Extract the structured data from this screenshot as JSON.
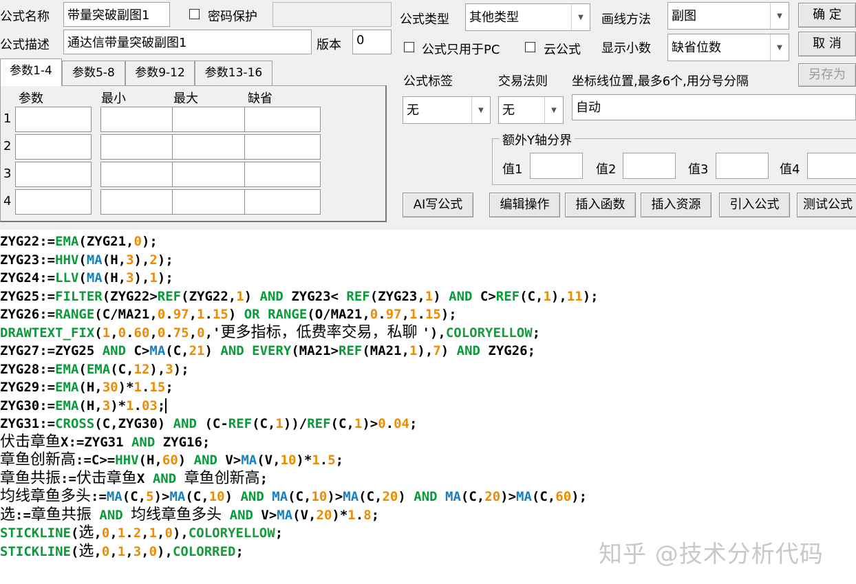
{
  "header": {
    "name_label": "公式名称",
    "name_value": "带量突破副图1",
    "password_label": "密码保护",
    "desc_label": "公式描述",
    "desc_value": "通达信带量突破副图1",
    "version_label": "版本",
    "version_value": "0",
    "type_label": "公式类型",
    "type_value": "其他类型",
    "draw_label": "画线方法",
    "draw_value": "副图",
    "pc_only_label": "公式只用于PC",
    "cloud_label": "云公式",
    "decimal_label": "显示小数",
    "decimal_value": "缺省位数",
    "tag_label": "公式标签",
    "tag_value": "无",
    "trade_label": "交易法则",
    "trade_value": "无",
    "axis_label": "坐标线位置,最多6个,用分号分隔",
    "axis_value": "自动",
    "extra_y_label": "额外Y轴分界",
    "y_labels": [
      "值1",
      "值2",
      "值3",
      "值4"
    ]
  },
  "buttons": {
    "ok": "确 定",
    "cancel": "取 消",
    "save_as": "另存为",
    "ai": "AI写公式",
    "edit": "编辑操作",
    "insert_func": "插入函数",
    "insert_res": "插入资源",
    "import": "引入公式",
    "test": "测试公式"
  },
  "params": {
    "tabs": [
      "参数1-4",
      "参数5-8",
      "参数9-12",
      "参数13-16"
    ],
    "columns": [
      "参数",
      "最小",
      "最大",
      "缺省"
    ],
    "rows": [
      "1",
      "2",
      "3",
      "4"
    ]
  },
  "code_lines": [
    [
      [
        "k",
        "ZYG22:="
      ],
      [
        "f",
        "EMA"
      ],
      [
        "k",
        "(ZYG21,"
      ],
      [
        "n",
        "0"
      ],
      [
        "k",
        ");"
      ]
    ],
    [
      [
        "k",
        "ZYG23:="
      ],
      [
        "f",
        "HHV"
      ],
      [
        "k",
        "("
      ],
      [
        "m",
        "MA"
      ],
      [
        "k",
        "(H,"
      ],
      [
        "n",
        "3"
      ],
      [
        "k",
        "),"
      ],
      [
        "n",
        "2"
      ],
      [
        "k",
        ");"
      ]
    ],
    [
      [
        "k",
        "ZYG24:="
      ],
      [
        "f",
        "LLV"
      ],
      [
        "k",
        "("
      ],
      [
        "m",
        "MA"
      ],
      [
        "k",
        "(H,"
      ],
      [
        "n",
        "3"
      ],
      [
        "k",
        "),"
      ],
      [
        "n",
        "1"
      ],
      [
        "k",
        ");"
      ]
    ],
    [
      [
        "k",
        "ZYG25:="
      ],
      [
        "f",
        "FILTER"
      ],
      [
        "k",
        "(ZYG22>"
      ],
      [
        "f",
        "REF"
      ],
      [
        "k",
        "(ZYG22,"
      ],
      [
        "n",
        "1"
      ],
      [
        "k",
        ") "
      ],
      [
        "f",
        "AND"
      ],
      [
        "k",
        " ZYG23< "
      ],
      [
        "f",
        "REF"
      ],
      [
        "k",
        "(ZYG23,"
      ],
      [
        "n",
        "1"
      ],
      [
        "k",
        ") "
      ],
      [
        "f",
        "AND"
      ],
      [
        "k",
        " C>"
      ],
      [
        "f",
        "REF"
      ],
      [
        "k",
        "(C,"
      ],
      [
        "n",
        "1"
      ],
      [
        "k",
        "),"
      ],
      [
        "n",
        "11"
      ],
      [
        "k",
        ");"
      ]
    ],
    [
      [
        "k",
        "ZYG26:="
      ],
      [
        "f",
        "RANGE"
      ],
      [
        "k",
        "(C/MA21,"
      ],
      [
        "n",
        "0"
      ],
      [
        "k",
        "."
      ],
      [
        "n",
        "97"
      ],
      [
        "k",
        ","
      ],
      [
        "n",
        "1"
      ],
      [
        "k",
        "."
      ],
      [
        "n",
        "15"
      ],
      [
        "k",
        ") "
      ],
      [
        "f",
        "OR"
      ],
      [
        "k",
        " "
      ],
      [
        "f",
        "RANGE"
      ],
      [
        "k",
        "(O/MA21,"
      ],
      [
        "n",
        "0"
      ],
      [
        "k",
        "."
      ],
      [
        "n",
        "97"
      ],
      [
        "k",
        ","
      ],
      [
        "n",
        "1"
      ],
      [
        "k",
        "."
      ],
      [
        "n",
        "15"
      ],
      [
        "k",
        ");"
      ]
    ],
    [
      [
        "f",
        "DRAWTEXT_FIX"
      ],
      [
        "k",
        "("
      ],
      [
        "n",
        "1"
      ],
      [
        "k",
        ","
      ],
      [
        "n",
        "0"
      ],
      [
        "k",
        "."
      ],
      [
        "n",
        "60"
      ],
      [
        "k",
        ","
      ],
      [
        "n",
        "0"
      ],
      [
        "k",
        "."
      ],
      [
        "n",
        "75"
      ],
      [
        "k",
        ","
      ],
      [
        "n",
        "0"
      ],
      [
        "k",
        ",'"
      ],
      [
        "c",
        "更多指标，低费率交易，私聊 "
      ],
      [
        "k",
        "'),"
      ],
      [
        "w",
        "COLORYELLOW"
      ],
      [
        "k",
        ";"
      ]
    ],
    [
      [
        "k",
        "ZYG27:=ZYG25 "
      ],
      [
        "f",
        "AND"
      ],
      [
        "k",
        " C>"
      ],
      [
        "m",
        "MA"
      ],
      [
        "k",
        "(C,"
      ],
      [
        "n",
        "21"
      ],
      [
        "k",
        ") "
      ],
      [
        "f",
        "AND"
      ],
      [
        "k",
        " "
      ],
      [
        "f",
        "EVERY"
      ],
      [
        "k",
        "(MA21>"
      ],
      [
        "f",
        "REF"
      ],
      [
        "k",
        "(MA21,"
      ],
      [
        "n",
        "1"
      ],
      [
        "k",
        "),"
      ],
      [
        "n",
        "7"
      ],
      [
        "k",
        ") "
      ],
      [
        "f",
        "AND"
      ],
      [
        "k",
        " ZYG26;"
      ]
    ],
    [
      [
        "k",
        "ZYG28:="
      ],
      [
        "f",
        "EMA"
      ],
      [
        "k",
        "("
      ],
      [
        "f",
        "EMA"
      ],
      [
        "k",
        "(C,"
      ],
      [
        "n",
        "12"
      ],
      [
        "k",
        "),"
      ],
      [
        "n",
        "3"
      ],
      [
        "k",
        ");"
      ]
    ],
    [
      [
        "k",
        "ZYG29:="
      ],
      [
        "f",
        "EMA"
      ],
      [
        "k",
        "(H,"
      ],
      [
        "n",
        "30"
      ],
      [
        "k",
        ")*"
      ],
      [
        "n",
        "1"
      ],
      [
        "k",
        "."
      ],
      [
        "n",
        "15"
      ],
      [
        "k",
        ";"
      ]
    ],
    [
      [
        "k",
        "ZYG30:="
      ],
      [
        "f",
        "EMA"
      ],
      [
        "k",
        "(H,"
      ],
      [
        "n",
        "3"
      ],
      [
        "k",
        ")*"
      ],
      [
        "n",
        "1"
      ],
      [
        "k",
        "."
      ],
      [
        "n",
        "03"
      ],
      [
        "k",
        ";"
      ],
      [
        "caret",
        ""
      ]
    ],
    [
      [
        "k",
        "ZYG31:="
      ],
      [
        "f",
        "CROSS"
      ],
      [
        "k",
        "(C,ZYG30) "
      ],
      [
        "f",
        "AND"
      ],
      [
        "k",
        " (C-"
      ],
      [
        "f",
        "REF"
      ],
      [
        "k",
        "(C,"
      ],
      [
        "n",
        "1"
      ],
      [
        "k",
        "))/"
      ],
      [
        "f",
        "REF"
      ],
      [
        "k",
        "(C,"
      ],
      [
        "n",
        "1"
      ],
      [
        "k",
        ")>"
      ],
      [
        "n",
        "0"
      ],
      [
        "k",
        "."
      ],
      [
        "n",
        "04"
      ],
      [
        "k",
        ";"
      ]
    ],
    [
      [
        "c",
        "伏击章鱼"
      ],
      [
        "k",
        "X:=ZYG31 "
      ],
      [
        "f",
        "AND"
      ],
      [
        "k",
        " ZYG16;"
      ]
    ],
    [
      [
        "c",
        "章鱼创新高"
      ],
      [
        "k",
        ":=C>="
      ],
      [
        "f",
        "HHV"
      ],
      [
        "k",
        "(H,"
      ],
      [
        "n",
        "60"
      ],
      [
        "k",
        ") "
      ],
      [
        "f",
        "AND"
      ],
      [
        "k",
        " V>"
      ],
      [
        "m",
        "MA"
      ],
      [
        "k",
        "(V,"
      ],
      [
        "n",
        "10"
      ],
      [
        "k",
        ")*"
      ],
      [
        "n",
        "1"
      ],
      [
        "k",
        "."
      ],
      [
        "n",
        "5"
      ],
      [
        "k",
        ";"
      ]
    ],
    [
      [
        "c",
        "章鱼共振"
      ],
      [
        "k",
        ":="
      ],
      [
        "c",
        "伏击章鱼"
      ],
      [
        "k",
        "X "
      ],
      [
        "f",
        "AND"
      ],
      [
        "k",
        " "
      ],
      [
        "c",
        "章鱼创新高"
      ],
      [
        "k",
        ";"
      ]
    ],
    [
      [
        "c",
        "均线章鱼多头"
      ],
      [
        "k",
        ":="
      ],
      [
        "m",
        "MA"
      ],
      [
        "k",
        "(C,"
      ],
      [
        "n",
        "5"
      ],
      [
        "k",
        ")>"
      ],
      [
        "m",
        "MA"
      ],
      [
        "k",
        "(C,"
      ],
      [
        "n",
        "10"
      ],
      [
        "k",
        ") "
      ],
      [
        "f",
        "AND"
      ],
      [
        "k",
        " "
      ],
      [
        "m",
        "MA"
      ],
      [
        "k",
        "(C,"
      ],
      [
        "n",
        "10"
      ],
      [
        "k",
        ")>"
      ],
      [
        "m",
        "MA"
      ],
      [
        "k",
        "(C,"
      ],
      [
        "n",
        "20"
      ],
      [
        "k",
        ") "
      ],
      [
        "f",
        "AND"
      ],
      [
        "k",
        " "
      ],
      [
        "m",
        "MA"
      ],
      [
        "k",
        "(C,"
      ],
      [
        "n",
        "20"
      ],
      [
        "k",
        ")>"
      ],
      [
        "m",
        "MA"
      ],
      [
        "k",
        "(C,"
      ],
      [
        "n",
        "60"
      ],
      [
        "k",
        ");"
      ]
    ],
    [
      [
        "c",
        "选"
      ],
      [
        "k",
        ":="
      ],
      [
        "c",
        "章鱼共振"
      ],
      [
        "k",
        " "
      ],
      [
        "f",
        "AND"
      ],
      [
        "k",
        " "
      ],
      [
        "c",
        "均线章鱼多头"
      ],
      [
        "k",
        " "
      ],
      [
        "f",
        "AND"
      ],
      [
        "k",
        " V>"
      ],
      [
        "m",
        "MA"
      ],
      [
        "k",
        "(V,"
      ],
      [
        "n",
        "20"
      ],
      [
        "k",
        ")*"
      ],
      [
        "n",
        "1"
      ],
      [
        "k",
        "."
      ],
      [
        "n",
        "8"
      ],
      [
        "k",
        ";"
      ]
    ],
    [
      [
        "f",
        "STICKLINE"
      ],
      [
        "k",
        "("
      ],
      [
        "c",
        "选"
      ],
      [
        "k",
        ","
      ],
      [
        "n",
        "0"
      ],
      [
        "k",
        ","
      ],
      [
        "n",
        "1"
      ],
      [
        "k",
        "."
      ],
      [
        "n",
        "2"
      ],
      [
        "k",
        ","
      ],
      [
        "n",
        "1"
      ],
      [
        "k",
        ","
      ],
      [
        "n",
        "0"
      ],
      [
        "k",
        "),"
      ],
      [
        "w",
        "COLORYELLOW"
      ],
      [
        "k",
        ";"
      ]
    ],
    [
      [
        "f",
        "STICKLINE"
      ],
      [
        "k",
        "("
      ],
      [
        "c",
        "选"
      ],
      [
        "k",
        ","
      ],
      [
        "n",
        "0"
      ],
      [
        "k",
        ","
      ],
      [
        "n",
        "1"
      ],
      [
        "k",
        ","
      ],
      [
        "n",
        "3"
      ],
      [
        "k",
        ","
      ],
      [
        "n",
        "0"
      ],
      [
        "k",
        "),"
      ],
      [
        "w",
        "COLORRED"
      ],
      [
        "k",
        ";"
      ]
    ]
  ],
  "watermark": "知乎 @技术分析代码"
}
